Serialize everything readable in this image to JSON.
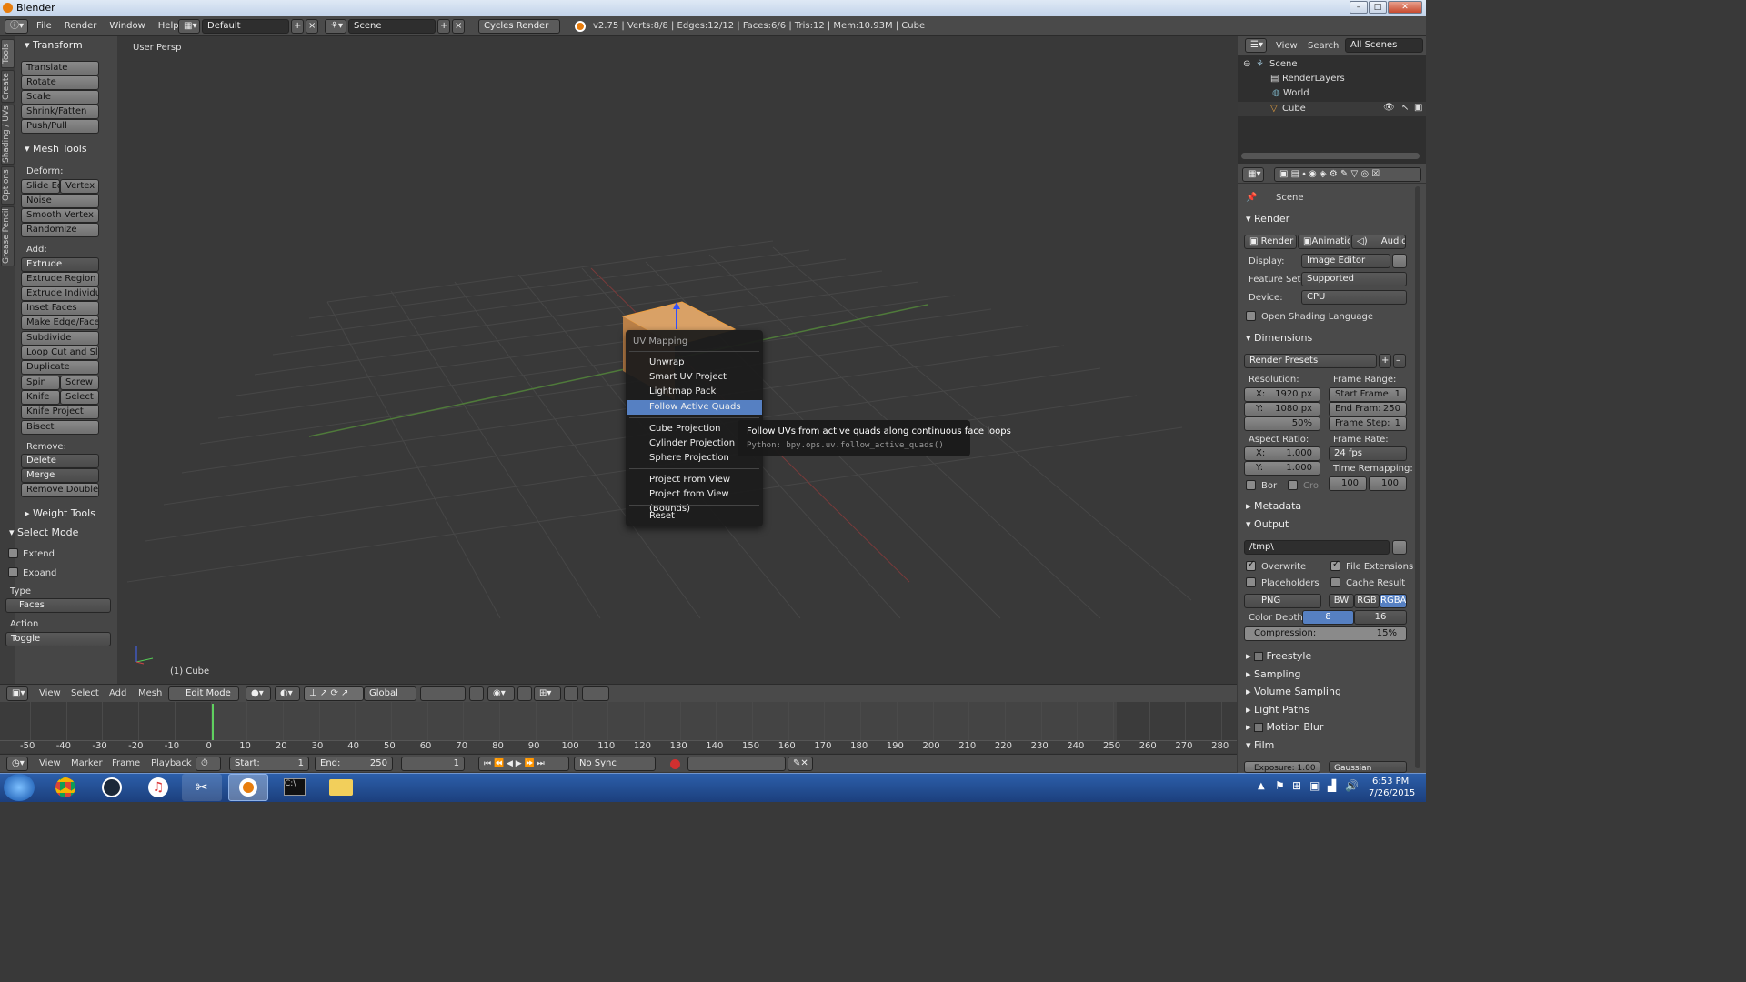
{
  "window": {
    "title": "Blender",
    "controls": [
      "–",
      "□",
      "✕"
    ]
  },
  "topbar": {
    "menus": [
      "File",
      "Render",
      "Window",
      "Help"
    ],
    "layout": "Default",
    "scene": "Scene",
    "engine": "Cycles Render",
    "stats": "v2.75 | Verts:8/8 | Edges:12/12 | Faces:6/6 | Tris:12 | Mem:10.93M | Cube"
  },
  "left_tabs": [
    "Tools",
    "Create",
    "Shading / UVs",
    "Options",
    "Grease Pencil"
  ],
  "tools": {
    "transform_header": "Transform",
    "translate": "Translate",
    "rotate": "Rotate",
    "scale": "Scale",
    "shrink": "Shrink/Fatten",
    "push": "Push/Pull",
    "mesh_header": "Mesh Tools",
    "deform": "Deform:",
    "slide_edge": "Slide Ed",
    "vertex": "Vertex",
    "noise": "Noise",
    "smooth": "Smooth Vertex",
    "randomize": "Randomize",
    "add": "Add:",
    "extrude": "Extrude",
    "extrude_region": "Extrude Region",
    "extrude_individual": "Extrude Individual",
    "inset": "Inset Faces",
    "make_edge": "Make Edge/Face",
    "subdivide": "Subdivide",
    "loopcut": "Loop Cut and Slide",
    "duplicate": "Duplicate",
    "spin": "Spin",
    "screw": "Screw",
    "knife": "Knife",
    "select": "Select",
    "knife_project": "Knife Project",
    "bisect": "Bisect",
    "remove": "Remove:",
    "delete": "Delete",
    "merge": "Merge",
    "remove_doubles": "Remove Doubles",
    "weight_header": "Weight Tools",
    "select_mode": "Select Mode",
    "extend": "Extend",
    "expand": "Expand",
    "type": "Type",
    "faces": "Faces",
    "action": "Action",
    "toggle": "Toggle"
  },
  "viewport": {
    "view_label": "User Persp",
    "object_label": "(1) Cube"
  },
  "uv_menu": {
    "title": "UV Mapping",
    "items": [
      "Unwrap",
      "Smart UV Project",
      "Lightmap Pack",
      "Follow Active Quads",
      "Cube Projection",
      "Cylinder Projection",
      "Sphere Projection",
      "Project From View",
      "Project from View (Bounds)",
      "Reset"
    ],
    "active_index": 3
  },
  "tooltip": {
    "text": "Follow UVs from active quads along continuous face loops",
    "python": "Python: bpy.ops.uv.follow_active_quads()"
  },
  "vp_header": {
    "view": "View",
    "select": "Select",
    "add": "Add",
    "mesh": "Mesh",
    "mode": "Edit Mode",
    "orientation": "Global"
  },
  "timeline": {
    "ticks": [
      "-50",
      "-40",
      "-30",
      "-20",
      "-10",
      "0",
      "10",
      "20",
      "30",
      "40",
      "50",
      "60",
      "70",
      "80",
      "90",
      "100",
      "110",
      "120",
      "130",
      "140",
      "150",
      "160",
      "170",
      "180",
      "190",
      "200",
      "210",
      "220",
      "230",
      "240",
      "250",
      "260",
      "270",
      "280"
    ],
    "view": "View",
    "marker": "Marker",
    "frame": "Frame",
    "playback": "Playback",
    "start": "Start:",
    "start_val": "1",
    "end": "End:",
    "end_val": "250",
    "current": "1",
    "sync": "No Sync"
  },
  "outliner": {
    "view": "View",
    "search": "Search",
    "filter": "All Scenes",
    "scene": "Scene",
    "renderlayers": "RenderLayers",
    "world": "World",
    "cube": "Cube"
  },
  "props": {
    "scene": "Scene",
    "render_header": "Render",
    "render_btn": "Render",
    "animation_btn": "Animation",
    "audio_btn": "Audio",
    "display_lbl": "Display:",
    "display_val": "Image Editor",
    "featureset_lbl": "Feature Set:",
    "featureset_val": "Supported",
    "device_lbl": "Device:",
    "device_val": "CPU",
    "osl": "Open Shading Language",
    "dimensions": "Dimensions",
    "presets": "Render Presets",
    "resolution": "Resolution:",
    "frame_range": "Frame Range:",
    "res_x": "X:",
    "res_x_val": "1920 px",
    "res_y": "Y:",
    "res_y_val": "1080 px",
    "res_pct": "50%",
    "start_frame": "Start Frame:",
    "start_frame_val": "1",
    "end_frame": "End Fram:",
    "end_frame_val": "250",
    "frame_step": "Frame Step:",
    "frame_step_val": "1",
    "aspect": "Aspect Ratio:",
    "frame_rate": "Frame Rate:",
    "asp_x": "X:",
    "asp_x_val": "1.000",
    "asp_y": "Y:",
    "asp_y_val": "1.000",
    "fps": "24 fps",
    "time_remap": "Time Remapping:",
    "bor": "Bor",
    "cro": "Cro",
    "remap_old": "100",
    "remap_new": "100",
    "metadata": "Metadata",
    "output": "Output",
    "path": "/tmp\\",
    "overwrite": "Overwrite",
    "file_ext": "File Extensions",
    "placeholders": "Placeholders",
    "cache": "Cache Result",
    "format": "PNG",
    "bw": "BW",
    "rgb": "RGB",
    "rgba": "RGBA",
    "color_depth": "Color Depth:",
    "depth8": "8",
    "depth16": "16",
    "compression": "Compression:",
    "compression_val": "15%",
    "freestyle": "Freestyle",
    "sampling": "Sampling",
    "volume": "Volume Sampling",
    "light_paths": "Light Paths",
    "motion_blur": "Motion Blur",
    "film": "Film",
    "exposure": "Exposure: 1.00",
    "filter": "Gaussian"
  },
  "taskbar": {
    "time": "6:53 PM",
    "date": "7/26/2015"
  }
}
